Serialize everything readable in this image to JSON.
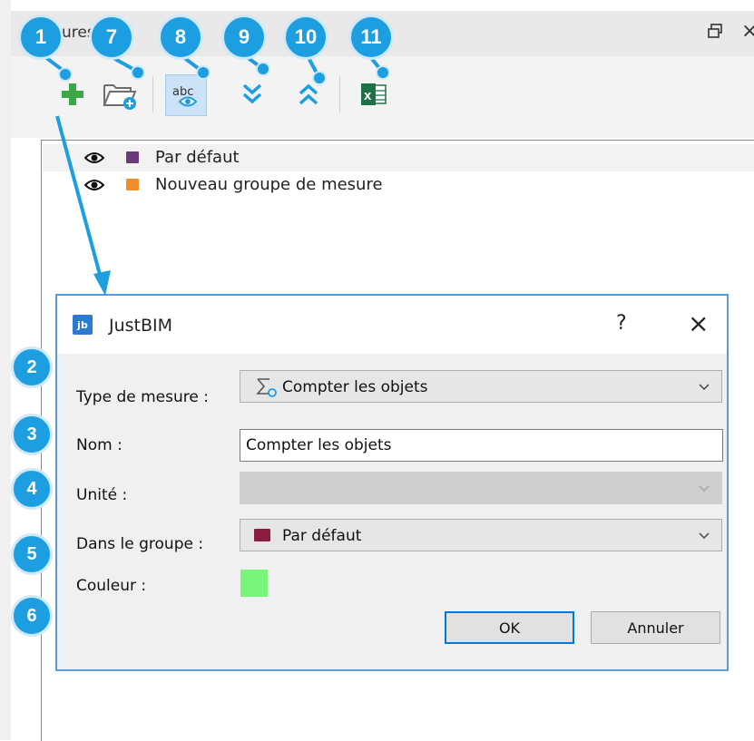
{
  "panel": {
    "title": "Mesures",
    "float_icon": "float-window-icon",
    "close_label": "×"
  },
  "toolbar": {
    "items": [
      {
        "name": "add-measure",
        "icon": "plus-icon"
      },
      {
        "name": "add-group",
        "icon": "folder-add-icon"
      },
      {
        "name": "show-labels",
        "icon": "abc-eye-icon",
        "label": "abc"
      },
      {
        "name": "expand-all",
        "icon": "double-chevron-down-icon"
      },
      {
        "name": "collapse-all",
        "icon": "double-chevron-up-icon"
      },
      {
        "name": "export-excel",
        "icon": "excel-icon",
        "label": "x"
      }
    ]
  },
  "tree": {
    "rows": [
      {
        "label": "Par défaut",
        "folder_color": "#6b3a7a"
      },
      {
        "label": "Nouveau groupe de mesure",
        "folder_color": "#f28c28"
      }
    ]
  },
  "dialog": {
    "logo": "jb",
    "title": "JustBIM",
    "help": "?",
    "close": "×",
    "type_label": "Type de mesure :",
    "type_value": "Compter les objets",
    "name_label": "Nom :",
    "name_value": "Compter les objets",
    "unit_label": "Unité :",
    "unit_value": "",
    "group_label": "Dans le groupe :",
    "group_value": "Par défaut",
    "group_folder_color": "#8b1e3f",
    "color_label": "Couleur :",
    "color_value": "#78f47a",
    "ok_label": "OK",
    "cancel_label": "Annuler"
  },
  "callouts": [
    "1",
    "7",
    "8",
    "9",
    "10",
    "11",
    "2",
    "3",
    "4",
    "5",
    "6"
  ],
  "accent_color": "#1c9ee0"
}
